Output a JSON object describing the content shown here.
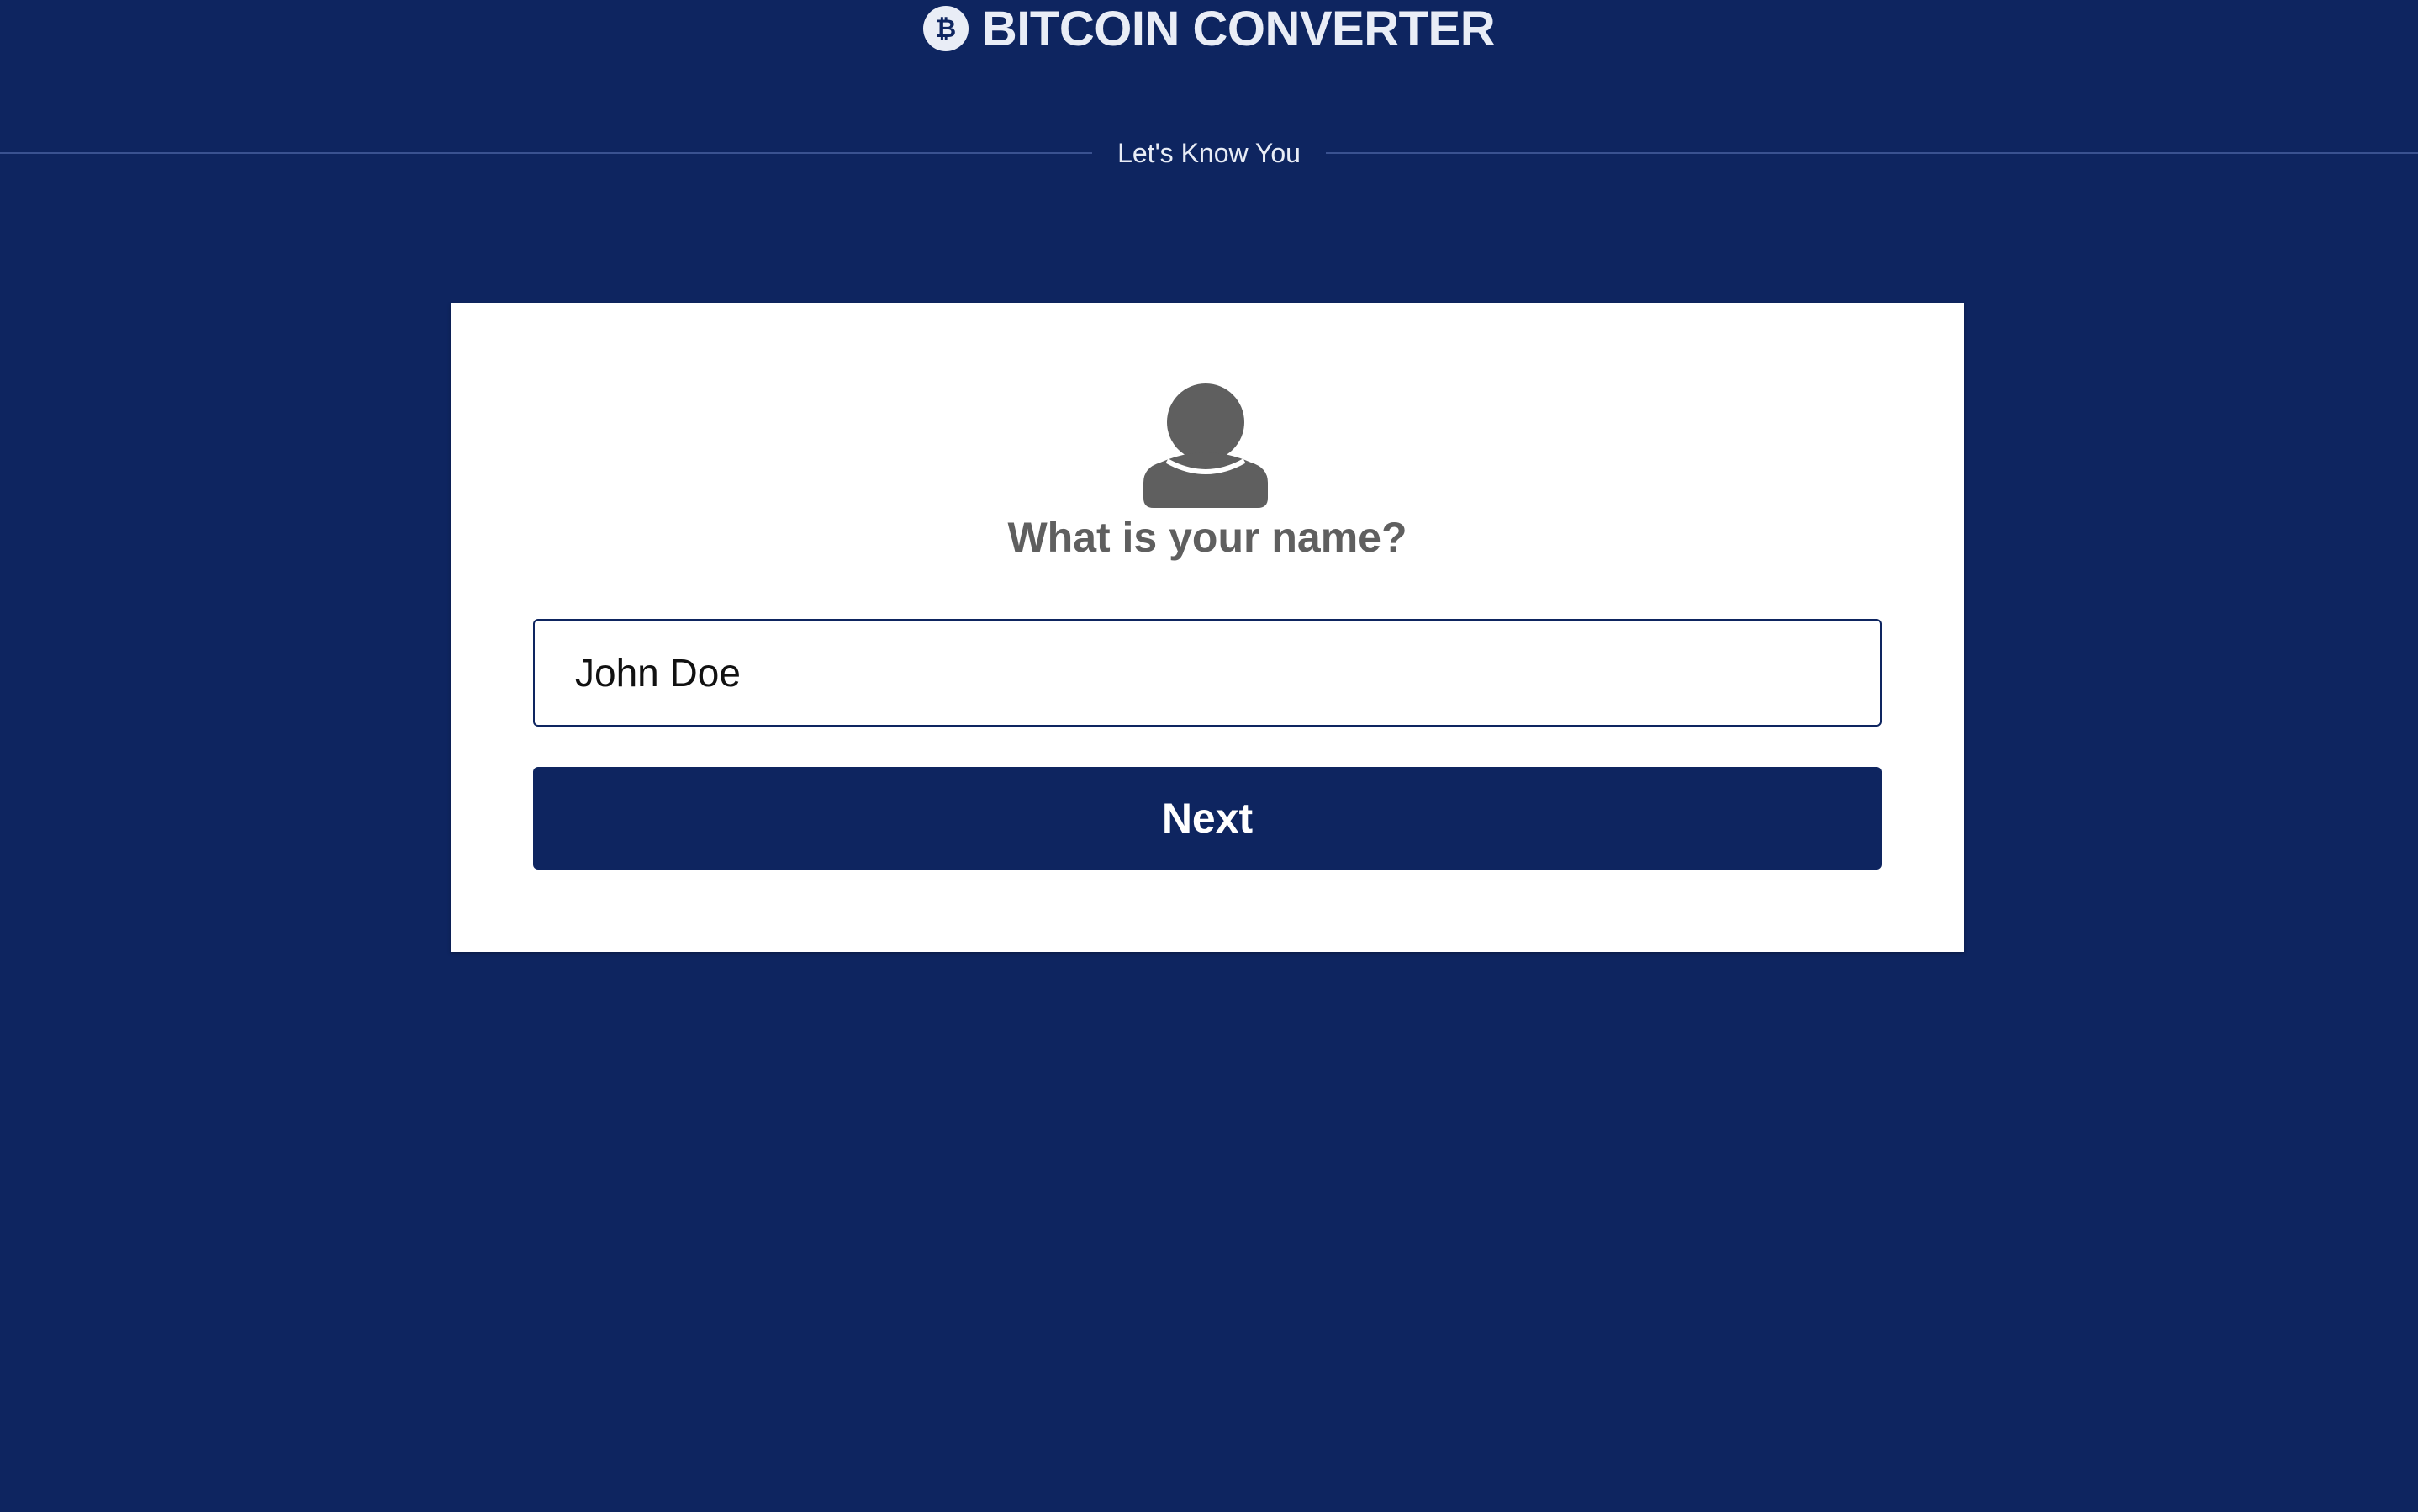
{
  "header": {
    "title": "BITCOIN CONVERTER",
    "logo_icon": "bitcoin-icon",
    "logo_glyph": "₿"
  },
  "divider": {
    "label": "Let's Know You"
  },
  "card": {
    "icon": "user-icon",
    "question": "What is your name?",
    "name_input": {
      "value": "John Doe",
      "placeholder": ""
    },
    "next_label": "Next"
  },
  "colors": {
    "background": "#0e2560",
    "card": "#ffffff",
    "text_gray": "#5f5f5f",
    "header_text": "#e9edf6"
  }
}
